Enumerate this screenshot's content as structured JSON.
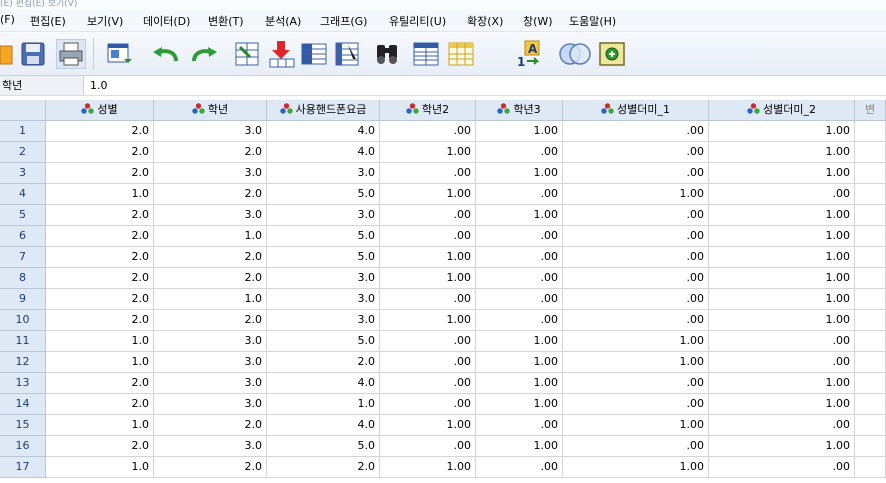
{
  "title_fragment": "(E) 편집(E) 보기(V)",
  "menu": [
    {
      "label": "(F)"
    },
    {
      "label": "편집(E)"
    },
    {
      "label": "보기(V)"
    },
    {
      "label": "데이터(D)"
    },
    {
      "label": "변환(T)"
    },
    {
      "label": "분석(A)"
    },
    {
      "label": "그래프(G)"
    },
    {
      "label": "유틸리티(U)"
    },
    {
      "label": "확장(X)"
    },
    {
      "label": "창(W)"
    },
    {
      "label": "도움말(H)"
    }
  ],
  "toolbar": {
    "icons": [
      "open-folder-icon",
      "save-icon",
      "print-icon",
      "recall-dialog-icon",
      "undo-icon",
      "redo-icon",
      "goto-case-icon",
      "goto-variable-icon",
      "variables-icon",
      "split-file-icon",
      "find-icon",
      "insert-cases-icon",
      "insert-variable-icon",
      "value-labels-icon",
      "use-sets-icon",
      "add-icon"
    ]
  },
  "cell_editor": {
    "reference": "학년",
    "value": "1.0"
  },
  "colors": {
    "header_bg": "#dfe8f5",
    "rownum_text": "#1a3d7a",
    "grid_line": "#d4d4d4"
  },
  "columns": [
    {
      "name": "성별"
    },
    {
      "name": "학년"
    },
    {
      "name": "사용핸드폰요금"
    },
    {
      "name": "학년2"
    },
    {
      "name": "학년3"
    },
    {
      "name": "성별더미_1"
    },
    {
      "name": "성별더미_2"
    },
    {
      "name": "변"
    }
  ],
  "rows": [
    {
      "n": "1",
      "cells": [
        "2.0",
        "3.0",
        "4.0",
        ".00",
        "1.00",
        ".00",
        "1.00"
      ]
    },
    {
      "n": "2",
      "cells": [
        "2.0",
        "2.0",
        "4.0",
        "1.00",
        ".00",
        ".00",
        "1.00"
      ]
    },
    {
      "n": "3",
      "cells": [
        "2.0",
        "3.0",
        "3.0",
        ".00",
        "1.00",
        ".00",
        "1.00"
      ]
    },
    {
      "n": "4",
      "cells": [
        "1.0",
        "2.0",
        "5.0",
        "1.00",
        ".00",
        "1.00",
        ".00"
      ]
    },
    {
      "n": "5",
      "cells": [
        "2.0",
        "3.0",
        "3.0",
        ".00",
        "1.00",
        ".00",
        "1.00"
      ]
    },
    {
      "n": "6",
      "cells": [
        "2.0",
        "1.0",
        "5.0",
        ".00",
        ".00",
        ".00",
        "1.00"
      ]
    },
    {
      "n": "7",
      "cells": [
        "2.0",
        "2.0",
        "5.0",
        "1.00",
        ".00",
        ".00",
        "1.00"
      ]
    },
    {
      "n": "8",
      "cells": [
        "2.0",
        "2.0",
        "3.0",
        "1.00",
        ".00",
        ".00",
        "1.00"
      ]
    },
    {
      "n": "9",
      "cells": [
        "2.0",
        "1.0",
        "3.0",
        ".00",
        ".00",
        ".00",
        "1.00"
      ]
    },
    {
      "n": "10",
      "cells": [
        "2.0",
        "2.0",
        "3.0",
        "1.00",
        ".00",
        ".00",
        "1.00"
      ]
    },
    {
      "n": "11",
      "cells": [
        "1.0",
        "3.0",
        "5.0",
        ".00",
        "1.00",
        "1.00",
        ".00"
      ]
    },
    {
      "n": "12",
      "cells": [
        "1.0",
        "3.0",
        "2.0",
        ".00",
        "1.00",
        "1.00",
        ".00"
      ]
    },
    {
      "n": "13",
      "cells": [
        "2.0",
        "3.0",
        "4.0",
        ".00",
        "1.00",
        ".00",
        "1.00"
      ]
    },
    {
      "n": "14",
      "cells": [
        "2.0",
        "3.0",
        "1.0",
        ".00",
        "1.00",
        ".00",
        "1.00"
      ]
    },
    {
      "n": "15",
      "cells": [
        "1.0",
        "2.0",
        "4.0",
        "1.00",
        ".00",
        "1.00",
        ".00"
      ]
    },
    {
      "n": "16",
      "cells": [
        "2.0",
        "3.0",
        "5.0",
        ".00",
        "1.00",
        ".00",
        "1.00"
      ]
    },
    {
      "n": "17",
      "cells": [
        "1.0",
        "2.0",
        "2.0",
        "1.00",
        ".00",
        "1.00",
        ".00"
      ]
    }
  ]
}
